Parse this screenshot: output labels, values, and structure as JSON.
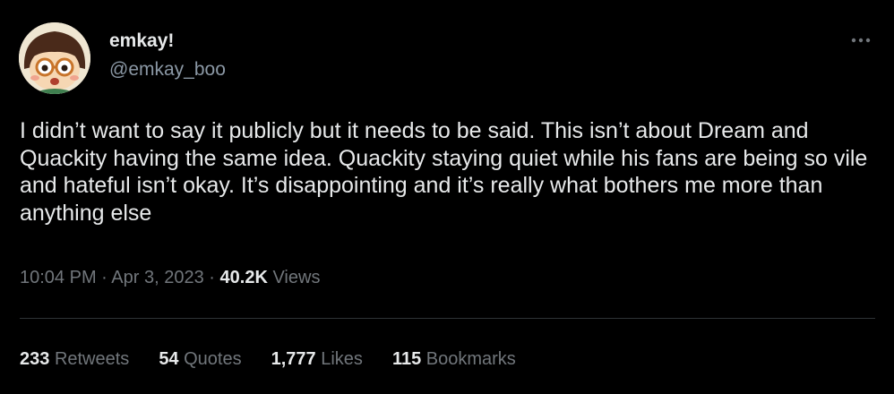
{
  "tweet": {
    "display_name": "emkay!",
    "handle": "@emkay_boo",
    "text": "I didn’t want to say it publicly but it needs to be said. This isn’t about Dream and Quackity having the same idea. Quackity staying quiet while his fans are being so vile and hateful isn’t okay. It’s disappointing and it’s really what bothers me more than anything else",
    "time": "10:04 PM",
    "separator": "·",
    "date": "Apr 3, 2023",
    "views_count": "40.2K",
    "views_label": "Views"
  },
  "stats": {
    "retweets_count": "233",
    "retweets_label": "Retweets",
    "quotes_count": "54",
    "quotes_label": "Quotes",
    "likes_count": "1,777",
    "likes_label": "Likes",
    "bookmarks_count": "115",
    "bookmarks_label": "Bookmarks"
  },
  "icons": {
    "more": "more-horizontal-icon"
  },
  "colors": {
    "background": "#000000",
    "primary_text": "#e7e9ea",
    "secondary_text": "#71767b",
    "divider": "#2f3336"
  }
}
